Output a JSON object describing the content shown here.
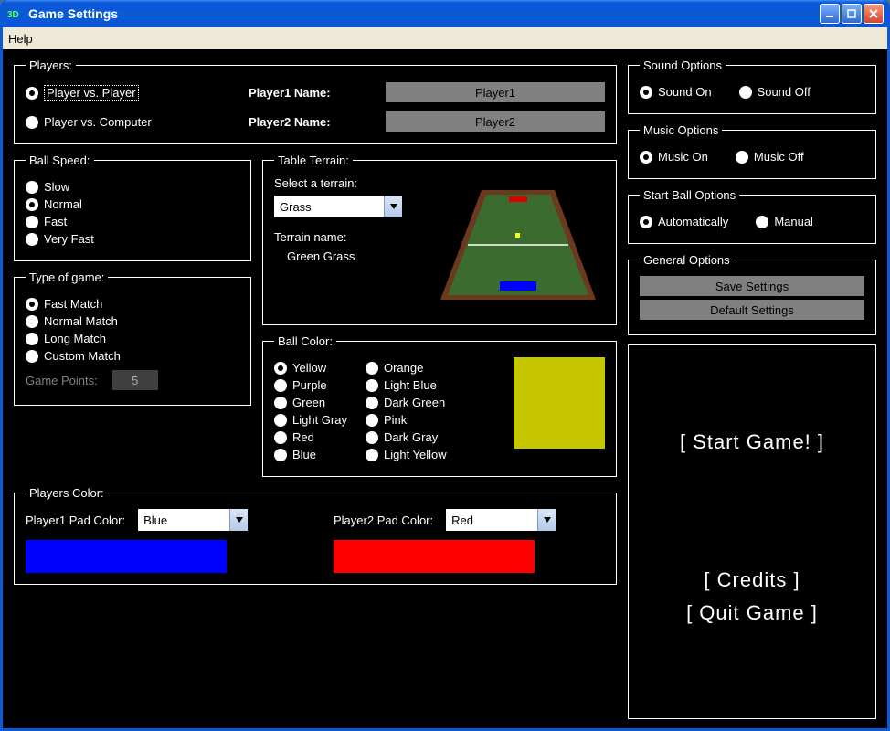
{
  "window": {
    "title": "Game Settings"
  },
  "menubar": {
    "help": "Help"
  },
  "players": {
    "legend": "Players:",
    "pvp": "Player vs. Player",
    "pvc": "Player vs. Computer",
    "selected": "pvp",
    "p1_label": "Player1 Name:",
    "p2_label": "Player2 Name:",
    "p1_name": "Player1",
    "p2_name": "Player2"
  },
  "ballspeed": {
    "legend": "Ball Speed:",
    "options": {
      "slow": "Slow",
      "normal": "Normal",
      "fast": "Fast",
      "veryfast": "Very Fast"
    },
    "selected": "normal"
  },
  "gametype": {
    "legend": "Type of game:",
    "options": {
      "fast": "Fast Match",
      "normal": "Normal Match",
      "long": "Long Match",
      "custom": "Custom Match"
    },
    "selected": "fast",
    "points_label": "Game Points:",
    "points_value": "5"
  },
  "terrain": {
    "legend": "Table Terrain:",
    "select_label": "Select a terrain:",
    "selected": "Grass",
    "name_label": "Terrain name:",
    "name_value": "Green Grass"
  },
  "ballcolor": {
    "legend": "Ball Color:",
    "col1": {
      "yellow": "Yellow",
      "purple": "Purple",
      "green": "Green",
      "lightgray": "Light Gray",
      "red": "Red",
      "blue": "Blue"
    },
    "col2": {
      "orange": "Orange",
      "lightblue": "Light Blue",
      "darkgreen": "Dark Green",
      "pink": "Pink",
      "darkgray": "Dark Gray",
      "lightyellow": "Light Yellow"
    },
    "selected": "yellow",
    "swatch": "#c6c600"
  },
  "playerscolor": {
    "legend": "Players Color:",
    "p1_label": "Player1 Pad Color:",
    "p1_value": "Blue",
    "p1_swatch": "#0000ff",
    "p2_label": "Player2 Pad Color:",
    "p2_value": "Red",
    "p2_swatch": "#ff0000"
  },
  "sound": {
    "legend": "Sound Options",
    "on": "Sound On",
    "off": "Sound Off",
    "selected": "on"
  },
  "music": {
    "legend": "Music Options",
    "on": "Music On",
    "off": "Music Off",
    "selected": "on"
  },
  "startball": {
    "legend": "Start Ball Options",
    "auto": "Automatically",
    "manual": "Manual",
    "selected": "auto"
  },
  "general": {
    "legend": "General Options",
    "save": "Save Settings",
    "default": "Default Settings"
  },
  "actions": {
    "start": "[ Start Game! ]",
    "credits": "[ Credits ]",
    "quit": "[ Quit Game ]"
  }
}
